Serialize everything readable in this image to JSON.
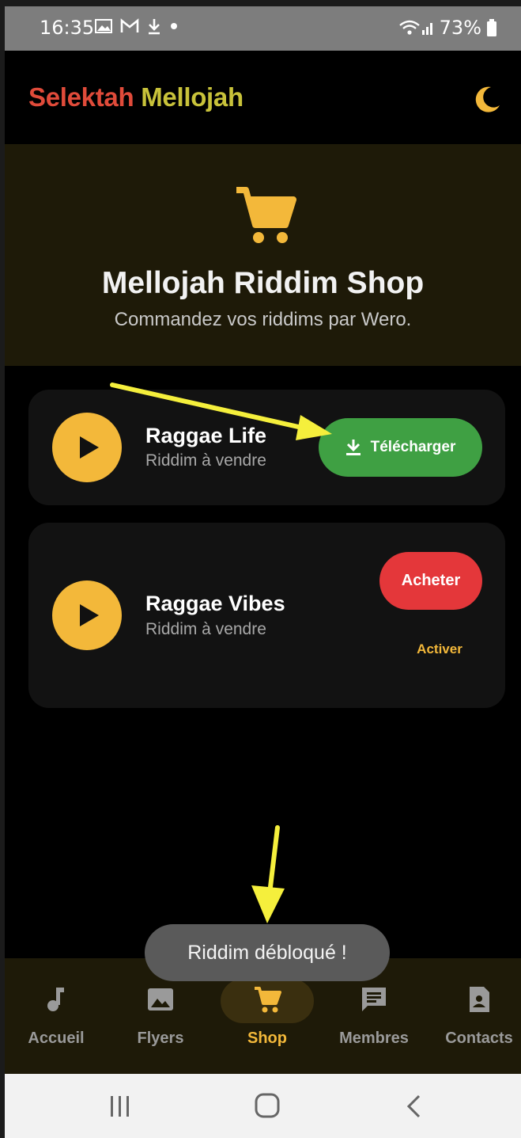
{
  "status_bar": {
    "time": "16:35",
    "battery": "73%"
  },
  "app": {
    "title_parts": [
      {
        "text": "Selektah ",
        "color": "#e04b3a"
      },
      {
        "text": "Mellojah",
        "color": "#c8c23a"
      }
    ],
    "theme_icon": "moon-icon"
  },
  "hero": {
    "icon": "cart-icon",
    "title": "Mellojah Riddim Shop",
    "subtitle": "Commandez vos riddims par Wero."
  },
  "items": [
    {
      "title": "Raggae Life",
      "subtitle": "Riddim à vendre",
      "action_label": "Télécharger",
      "action_icon": "download-icon",
      "action_color": "#3fa043"
    },
    {
      "title": "Raggae Vibes",
      "subtitle": "Riddim à vendre",
      "action_label": "Acheter",
      "action_color": "#e4373a",
      "secondary_label": "Activer"
    }
  ],
  "toast": "Riddim débloqué !",
  "bottom_nav": [
    {
      "label": "Accueil",
      "icon": "music-note-icon",
      "active": false
    },
    {
      "label": "Flyers",
      "icon": "image-icon",
      "active": false
    },
    {
      "label": "Shop",
      "icon": "cart-icon",
      "active": true
    },
    {
      "label": "Membres",
      "icon": "chat-icon",
      "active": false
    },
    {
      "label": "Contacts",
      "icon": "contact-card-icon",
      "active": false
    }
  ],
  "colors": {
    "accent": "#f3b83a",
    "annotation_arrow": "#f5ef3c"
  }
}
